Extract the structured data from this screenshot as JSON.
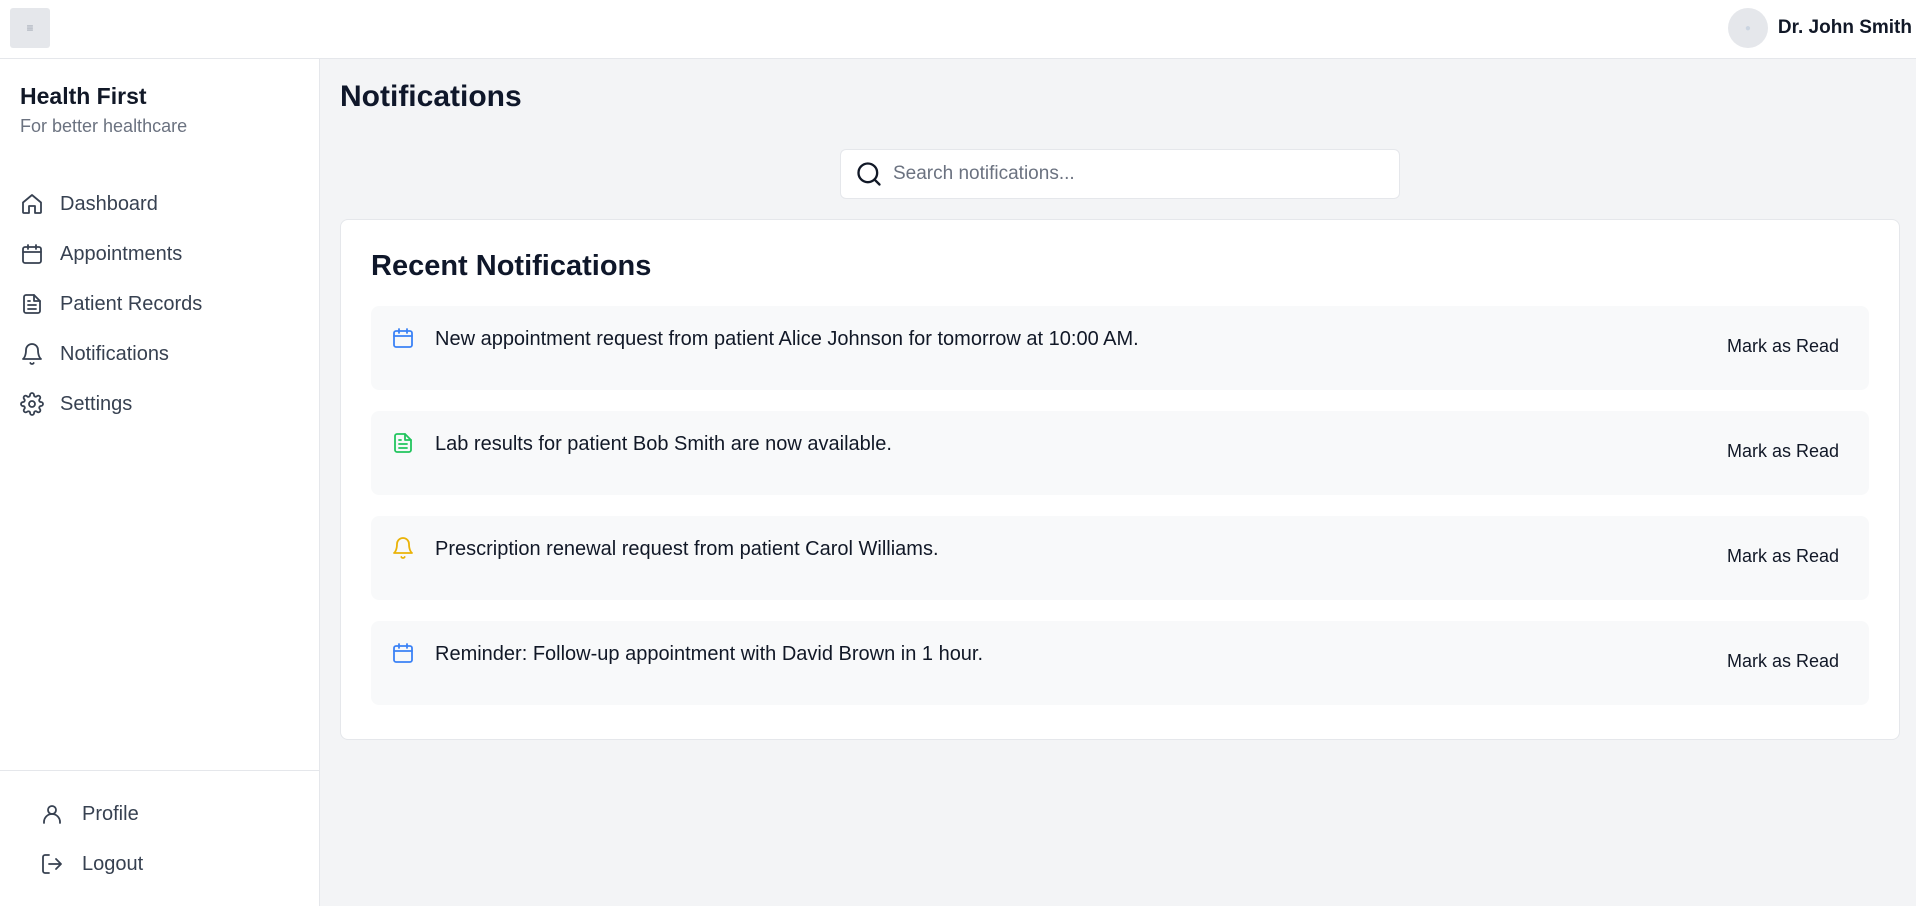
{
  "header": {
    "menu_toggle_icon": "menu-icon",
    "user_name": "Dr. John Smith",
    "avatar_icon": "user-avatar-icon"
  },
  "sidebar": {
    "brand_title": "Health First",
    "brand_subtitle": "For better healthcare",
    "items": [
      {
        "label": "Dashboard",
        "icon": "home-icon"
      },
      {
        "label": "Appointments",
        "icon": "calendar-icon"
      },
      {
        "label": "Patient Records",
        "icon": "document-icon"
      },
      {
        "label": "Notifications",
        "icon": "bell-icon"
      },
      {
        "label": "Settings",
        "icon": "gear-icon"
      }
    ],
    "bottom_items": [
      {
        "label": "Profile",
        "icon": "user-icon"
      },
      {
        "label": "Logout",
        "icon": "logout-icon"
      }
    ]
  },
  "main": {
    "page_title": "Notifications",
    "search": {
      "placeholder": "Search notifications...",
      "value": ""
    },
    "card_title": "Recent Notifications",
    "notifications": [
      {
        "text": "New appointment request from patient Alice Johnson for tomorrow at 10:00 AM.",
        "icon": "calendar-icon",
        "icon_color": "#3b82f6",
        "action": "Mark as Read"
      },
      {
        "text": "Lab results for patient Bob Smith are now available.",
        "icon": "document-icon",
        "icon_color": "#22c55e",
        "action": "Mark as Read"
      },
      {
        "text": "Prescription renewal request from patient Carol Williams.",
        "icon": "bell-icon",
        "icon_color": "#eab308",
        "action": "Mark as Read"
      },
      {
        "text": "Reminder: Follow-up appointment with David Brown in 1 hour.",
        "icon": "calendar-icon",
        "icon_color": "#3b82f6",
        "action": "Mark as Read"
      }
    ]
  },
  "colors": {
    "background": "#f3f4f6",
    "surface": "#ffffff",
    "notification_bg": "#f8f9fa",
    "text_primary": "#111827",
    "text_muted": "#6b7280"
  }
}
